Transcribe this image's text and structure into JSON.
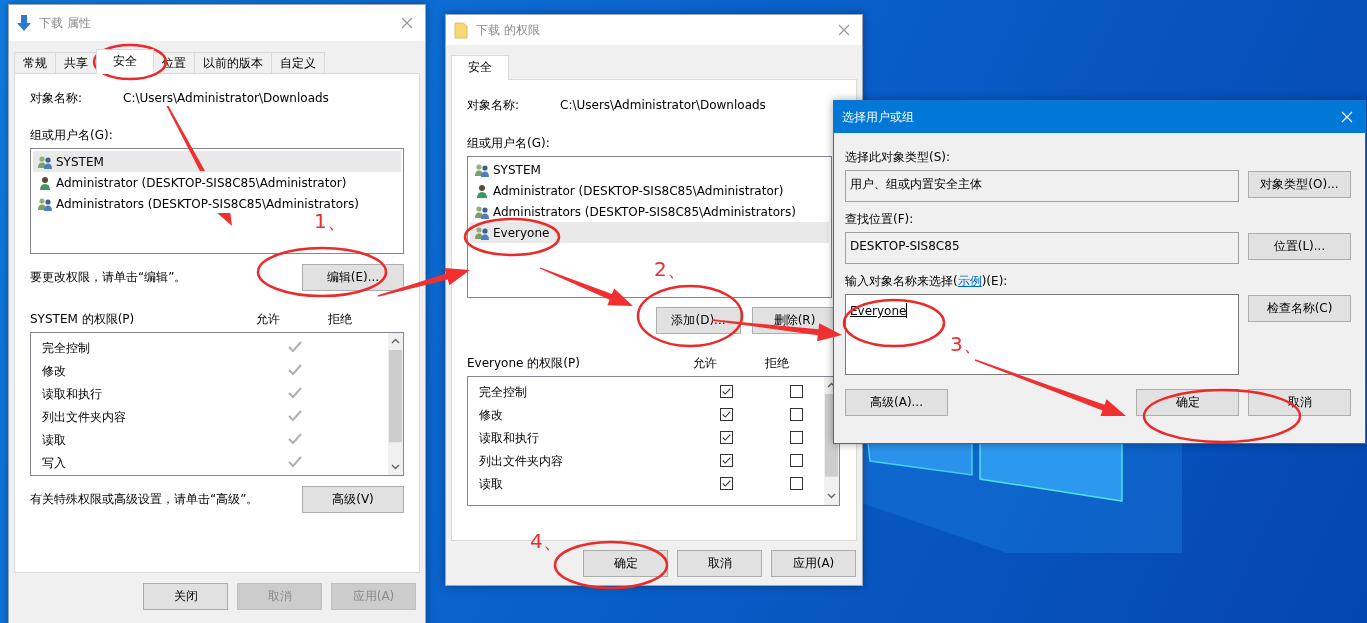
{
  "properties_window": {
    "title": "下载 属性",
    "tabs": [
      {
        "label": "常规",
        "selected": false
      },
      {
        "label": "共享",
        "selected": false
      },
      {
        "label": "安全",
        "selected": true
      },
      {
        "label": "位置",
        "selected": false
      },
      {
        "label": "以前的版本",
        "selected": false
      },
      {
        "label": "自定义",
        "selected": false
      }
    ],
    "object_label": "对象名称:",
    "object_path": "C:\\Users\\Administrator\\Downloads",
    "groups_label": "组或用户名(G):",
    "principals": [
      {
        "name": "SYSTEM",
        "kind": "group",
        "selected": true
      },
      {
        "name": "Administrator (DESKTOP-SIS8C85\\Administrator)",
        "kind": "user",
        "selected": false
      },
      {
        "name": "Administrators (DESKTOP-SIS8C85\\Administrators)",
        "kind": "group",
        "selected": false
      }
    ],
    "edit_hint": "要更改权限，请单击“编辑”。",
    "edit_button": "编辑(E)...",
    "permissions_label": "SYSTEM 的权限(P)",
    "allow_header": "允许",
    "deny_header": "拒绝",
    "permissions": [
      {
        "name": "完全控制",
        "allow": true,
        "deny": false
      },
      {
        "name": "修改",
        "allow": true,
        "deny": false
      },
      {
        "name": "读取和执行",
        "allow": true,
        "deny": false
      },
      {
        "name": "列出文件夹内容",
        "allow": true,
        "deny": false
      },
      {
        "name": "读取",
        "allow": true,
        "deny": false
      },
      {
        "name": "写入",
        "allow": true,
        "deny": false
      }
    ],
    "advanced_hint": "有关特殊权限或高级设置，请单击“高级”。",
    "advanced_button": "高级(V)",
    "buttons": [
      {
        "label": "关闭",
        "disabled": false
      },
      {
        "label": "取消",
        "disabled": true
      },
      {
        "label": "应用(A)",
        "disabled": true
      }
    ]
  },
  "permissions_window": {
    "title": "下载 的权限",
    "tabs": [
      {
        "label": "安全",
        "selected": true
      }
    ],
    "object_label": "对象名称:",
    "object_path": "C:\\Users\\Administrator\\Downloads",
    "groups_label": "组或用户名(G):",
    "principals": [
      {
        "name": "SYSTEM",
        "kind": "group",
        "selected": false
      },
      {
        "name": "Administrator (DESKTOP-SIS8C85\\Administrator)",
        "kind": "user",
        "selected": false
      },
      {
        "name": "Administrators (DESKTOP-SIS8C85\\Administrators)",
        "kind": "group",
        "selected": false
      },
      {
        "name": "Everyone",
        "kind": "group",
        "selected": true
      }
    ],
    "add_button": "添加(D)...",
    "remove_button": "删除(R)",
    "permissions_label": "Everyone 的权限(P)",
    "allow_header": "允许",
    "deny_header": "拒绝",
    "permissions": [
      {
        "name": "完全控制",
        "allow": true,
        "deny": false
      },
      {
        "name": "修改",
        "allow": true,
        "deny": false
      },
      {
        "name": "读取和执行",
        "allow": true,
        "deny": false
      },
      {
        "name": "列出文件夹内容",
        "allow": true,
        "deny": false
      },
      {
        "name": "读取",
        "allow": true,
        "deny": false
      }
    ],
    "buttons": [
      {
        "label": "确定",
        "disabled": false
      },
      {
        "label": "取消",
        "disabled": false
      },
      {
        "label": "应用(A)",
        "disabled": false
      }
    ]
  },
  "select_dialog": {
    "title": "选择用户或组",
    "type_label": "选择此对象类型(S):",
    "type_value": "用户、组或内置安全主体",
    "type_button": "对象类型(O)...",
    "location_label": "查找位置(F):",
    "location_value": "DESKTOP-SIS8C85",
    "location_button": "位置(L)...",
    "names_label": {
      "prefix": "输入对象名称来选择(",
      "link": "示例",
      "suffix": ")(E):"
    },
    "names_value": "Everyone",
    "check_button": "检查名称(C)",
    "advanced_button": "高级(A)...",
    "buttons": [
      {
        "label": "确定"
      },
      {
        "label": "取消"
      }
    ]
  },
  "annotations": {
    "steps": [
      {
        "label": "1、"
      },
      {
        "label": "2、"
      },
      {
        "label": "3、"
      },
      {
        "label": "4、"
      }
    ]
  }
}
